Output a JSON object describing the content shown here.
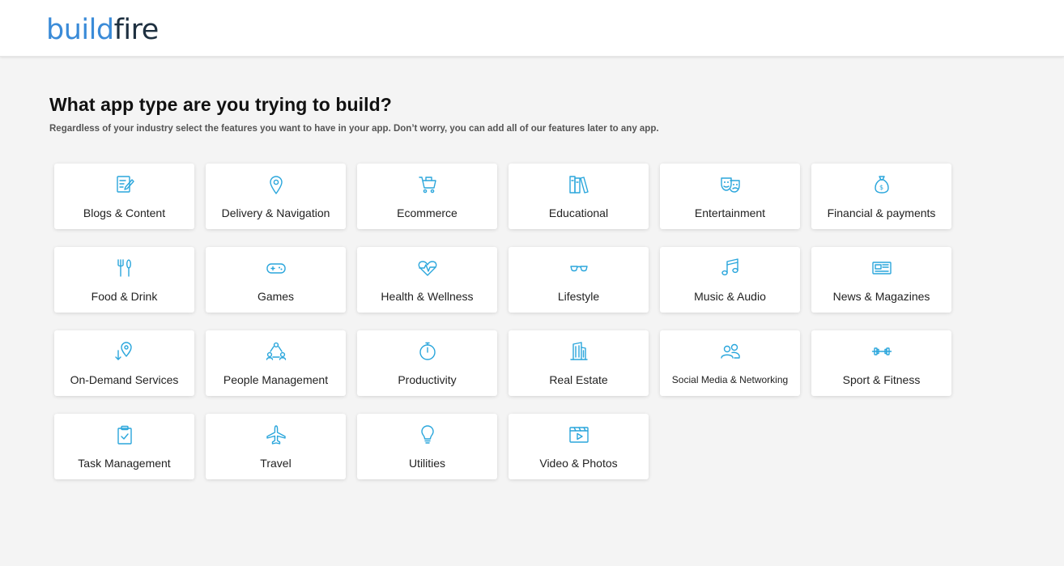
{
  "logo": {
    "build": "build",
    "fire": "fire"
  },
  "page": {
    "title": "What app type are you trying to build?",
    "subtitle": "Regardless of your industry select the features you want to have in your app. Don’t worry, you can add all of our features later to any app."
  },
  "categories": [
    {
      "label": "Blogs & Content",
      "icon": "blog-icon"
    },
    {
      "label": "Delivery & Navigation",
      "icon": "map-pin-icon"
    },
    {
      "label": "Ecommerce",
      "icon": "shopping-cart-icon"
    },
    {
      "label": "Educational",
      "icon": "books-icon"
    },
    {
      "label": "Entertainment",
      "icon": "theater-masks-icon"
    },
    {
      "label": "Financial & payments",
      "icon": "money-bag-icon"
    },
    {
      "label": "Food & Drink",
      "icon": "fork-knife-icon"
    },
    {
      "label": "Games",
      "icon": "gamepad-icon"
    },
    {
      "label": "Health & Wellness",
      "icon": "heartbeat-icon"
    },
    {
      "label": "Lifestyle",
      "icon": "sunglasses-icon"
    },
    {
      "label": "Music & Audio",
      "icon": "music-note-icon"
    },
    {
      "label": "News & Magazines",
      "icon": "newspaper-icon"
    },
    {
      "label": "On-Demand Services",
      "icon": "location-arrow-icon"
    },
    {
      "label": "People Management",
      "icon": "people-network-icon"
    },
    {
      "label": "Productivity",
      "icon": "stopwatch-icon"
    },
    {
      "label": "Real Estate",
      "icon": "building-icon"
    },
    {
      "label": "Social Media & Networking",
      "icon": "users-icon"
    },
    {
      "label": "Sport & Fitness",
      "icon": "dumbbell-icon"
    },
    {
      "label": "Task Management",
      "icon": "clipboard-check-icon"
    },
    {
      "label": "Travel",
      "icon": "airplane-icon"
    },
    {
      "label": "Utilities",
      "icon": "lightbulb-icon"
    },
    {
      "label": "Video & Photos",
      "icon": "video-icon"
    }
  ]
}
